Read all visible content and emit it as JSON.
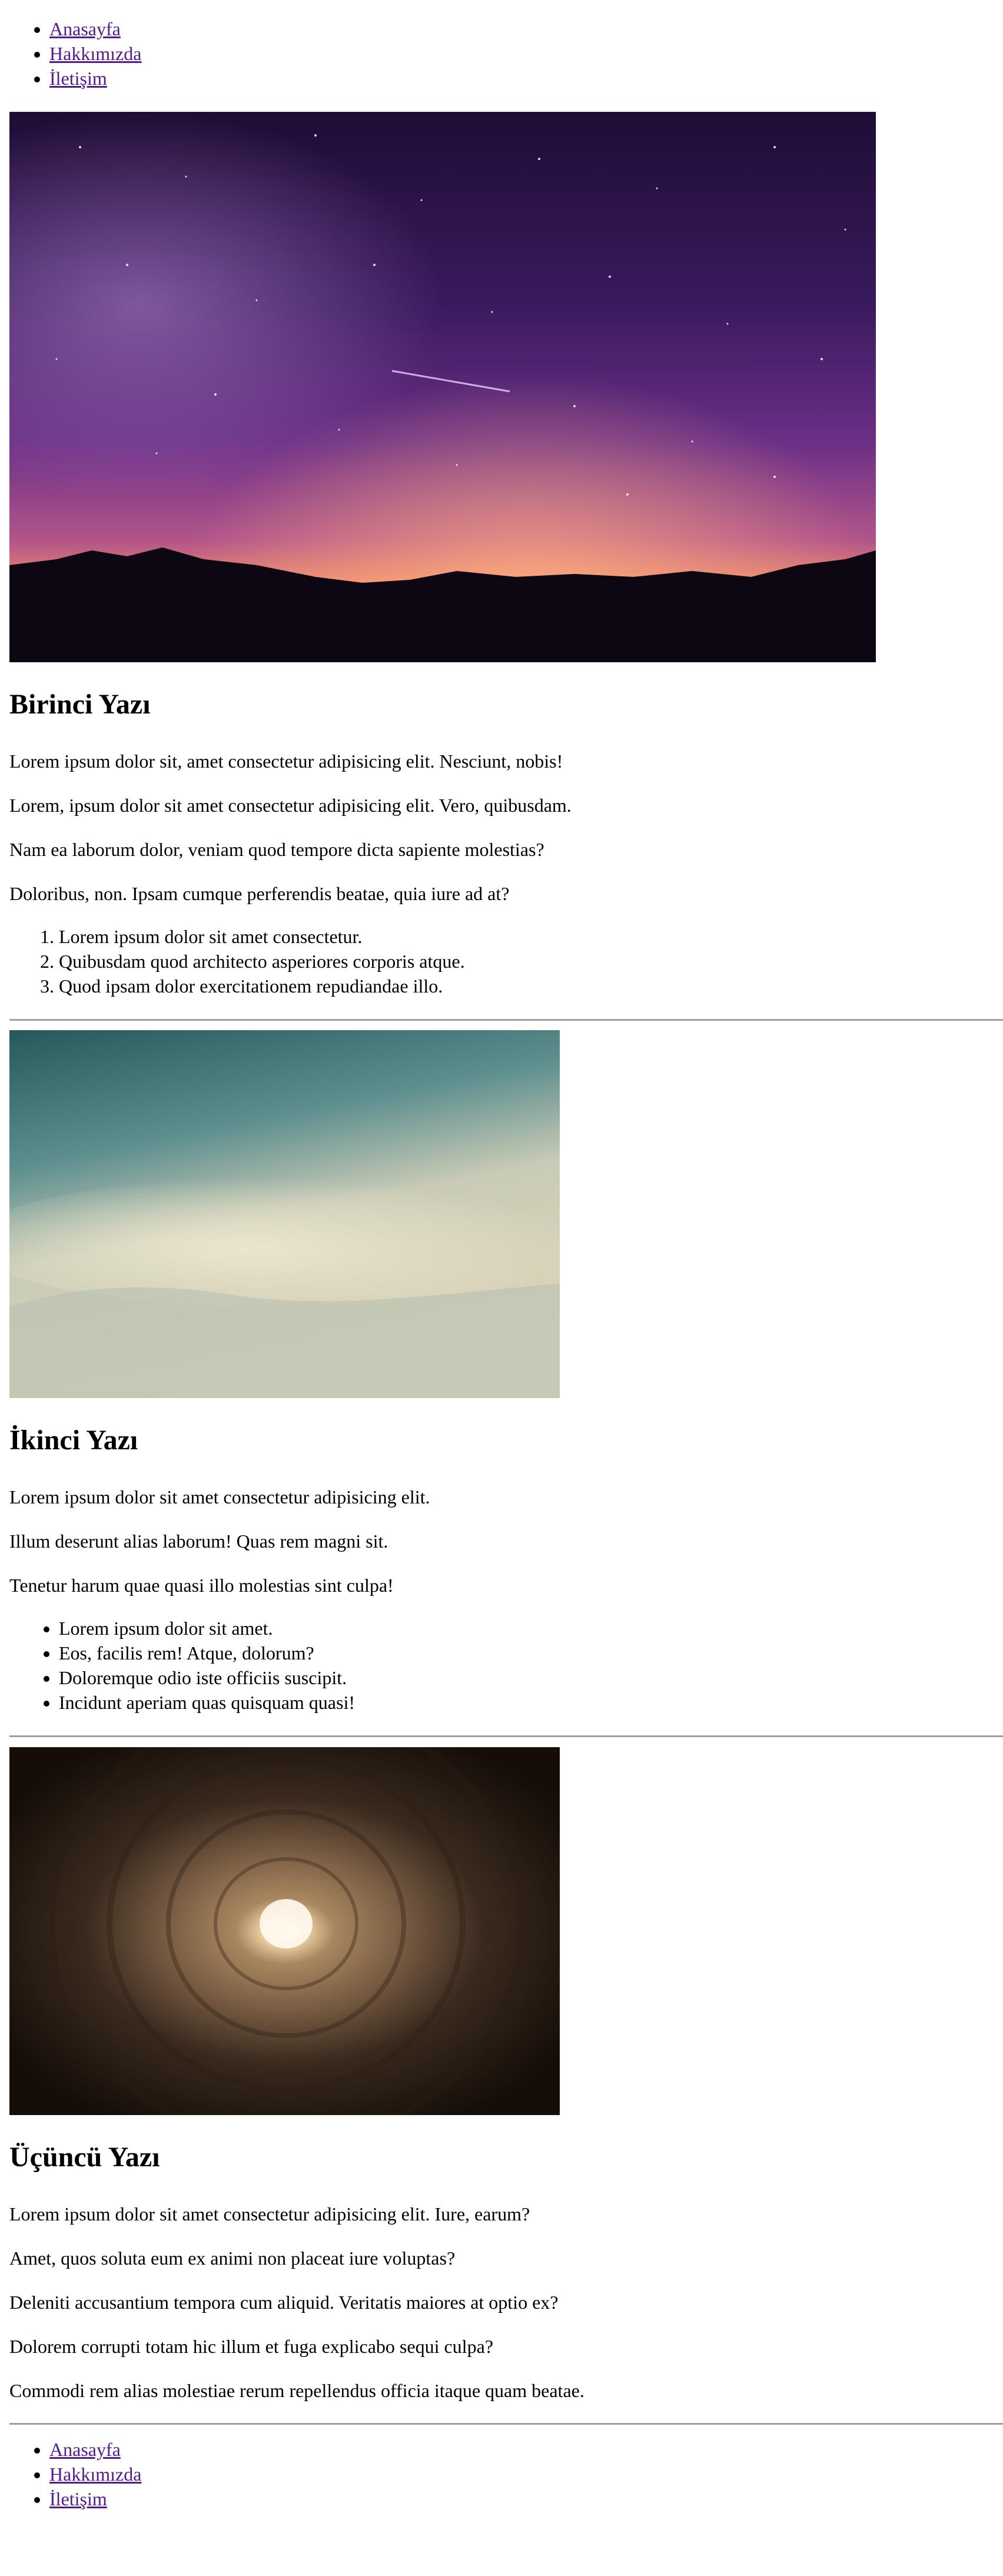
{
  "nav": {
    "items": [
      {
        "label": "Anasayfa"
      },
      {
        "label": "Hakkımızda"
      },
      {
        "label": "İletişim"
      }
    ]
  },
  "posts": [
    {
      "image": "night-sky-milky-way-mountains",
      "title": "Birinci Yazı",
      "paragraphs": [
        "Lorem ipsum dolor sit, amet consectetur adipisicing elit. Nesciunt, nobis!",
        "Lorem, ipsum dolor sit amet consectetur adipisicing elit. Vero, quibusdam.",
        "Nam ea laborum dolor, veniam quod tempore dicta sapiente molestias?",
        "Doloribus, non. Ipsam cumque perferendis beatae, quia iure ad at?"
      ],
      "ordered_list": [
        "Lorem ipsum dolor sit amet consectetur.",
        "Quibusdam quod architecto asperiores corporis atque.",
        "Quod ipsam dolor exercitationem repudiandae illo."
      ]
    },
    {
      "image": "cloudy-sky",
      "title": "İkinci Yazı",
      "paragraphs": [
        "Lorem ipsum dolor sit amet consectetur adipisicing elit.",
        "Illum deserunt alias laborum! Quas rem magni sit.",
        "Tenetur harum quae quasi illo molestias sint culpa!"
      ],
      "unordered_list": [
        "Lorem ipsum dolor sit amet.",
        "Eos, facilis rem! Atque, dolorum?",
        "Doloremque odio iste officiis suscipit.",
        "Incidunt aperiam quas quisquam quasi!"
      ]
    },
    {
      "image": "tunnel-light",
      "title": "Üçüncü Yazı",
      "paragraphs": [
        "Lorem ipsum dolor sit amet consectetur adipisicing elit. Iure, earum?",
        "Amet, quos soluta eum ex animi non placeat iure voluptas?",
        "Deleniti accusantium tempora cum aliquid. Veritatis maiores at optio ex?",
        "Dolorem corrupti totam hic illum et fuga explicabo sequi culpa?",
        "Commodi rem alias molestiae rerum repellendus officia itaque quam beatae."
      ]
    }
  ],
  "footer_nav": {
    "items": [
      {
        "label": "Anasayfa"
      },
      {
        "label": "Hakkımızda"
      },
      {
        "label": "İletişim"
      }
    ]
  },
  "colors": {
    "link": "#551a8b",
    "divider": "#a0a0a0"
  }
}
